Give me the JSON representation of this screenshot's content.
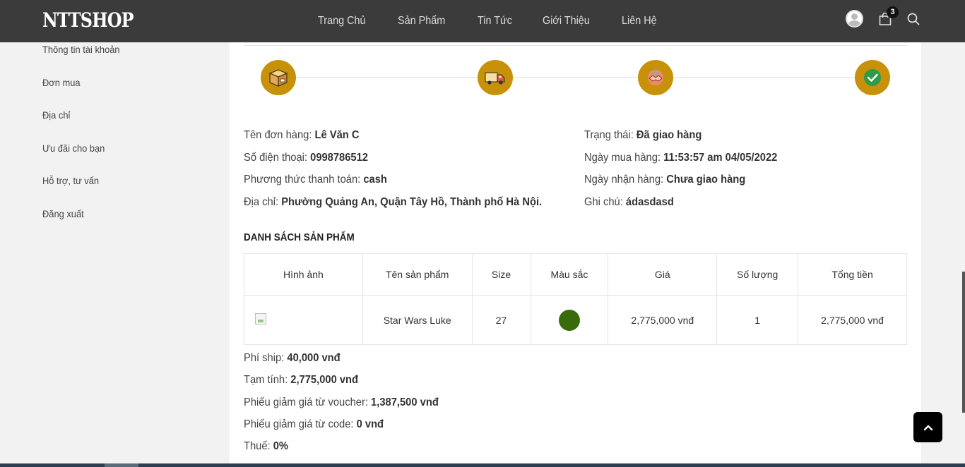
{
  "header": {
    "logo": "NTTSHOP",
    "nav": [
      "Trang Chủ",
      "Sản Phẩm",
      "Tin Tức",
      "Giới Thiệu",
      "Liên Hệ"
    ],
    "cart_count": "3"
  },
  "sidebar": {
    "items": [
      "Thông tin tài khoản",
      "Đơn mua",
      "Địa chỉ",
      "Ưu đãi cho bạn",
      "Hỗ trợ, tư vấn",
      "Đăng xuất"
    ]
  },
  "order": {
    "name_label": "Tên đơn hàng:",
    "name": "Lê Văn C",
    "phone_label": "Số điện thoại:",
    "phone": "0998786512",
    "payment_label": "Phương thức thanh toán:",
    "payment": "cash",
    "address_label": "Địa chỉ:",
    "address": "Phường Quảng An, Quận Tây Hồ, Thành phố Hà Nội.",
    "status_label": "Trạng thái:",
    "status": "Đã giao hàng",
    "order_date_label": "Ngày mua hàng:",
    "order_date": "11:53:57 am 04/05/2022",
    "received_label": "Ngày nhận hàng:",
    "received": "Chưa giao hàng",
    "note_label": "Ghi chú:",
    "note": "ádasdasd"
  },
  "products": {
    "title": "DANH SÁCH SẢN PHẨM",
    "headers": [
      "Hình ảnh",
      "Tên sản phẩm",
      "Size",
      "Màu sắc",
      "Giá",
      "Số lượng",
      "Tổng tiền"
    ],
    "rows": [
      {
        "name": "Star Wars Luke",
        "size": "27",
        "color": "#3a6b0a",
        "price": "2,775,000 vnđ",
        "quantity": "1",
        "total": "2,775,000 vnđ"
      }
    ]
  },
  "totals": {
    "ship_label": "Phí ship:",
    "ship": "40,000 vnđ",
    "subtotal_label": "Tạm tính:",
    "subtotal": "2,775,000 vnđ",
    "voucher_label": "Phiếu giảm giá từ voucher:",
    "voucher": "1,387,500 vnđ",
    "code_label": "Phiếu giảm giá từ code:",
    "code": "0 vnđ",
    "tax_label": "Thuế:",
    "tax": "0%"
  },
  "colors": {
    "accent": "#c8910a",
    "header_bg": "#3b3b3b"
  }
}
